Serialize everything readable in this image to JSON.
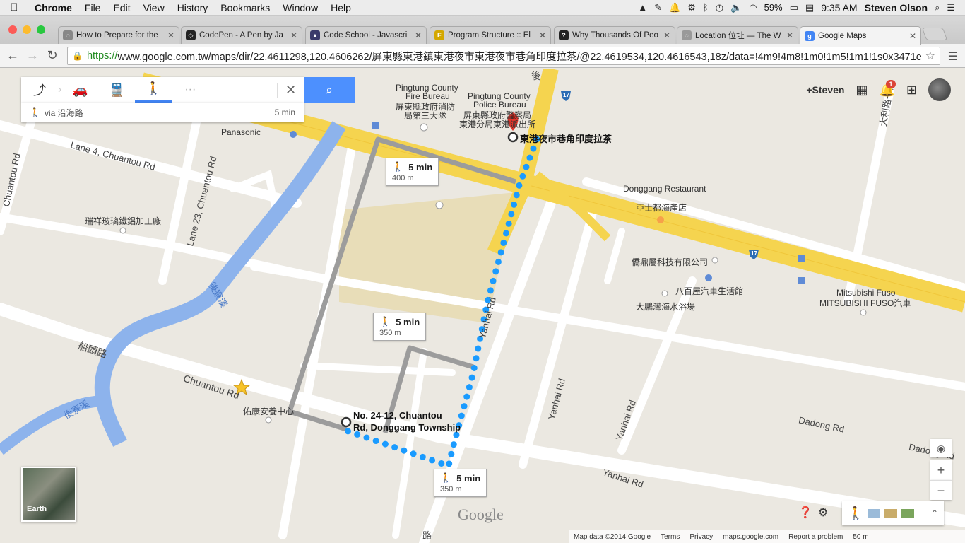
{
  "menubar": {
    "app": "Chrome",
    "menus": [
      "File",
      "Edit",
      "View",
      "History",
      "Bookmarks",
      "Window",
      "Help"
    ],
    "battery": "59%",
    "time": "9:35 AM",
    "user": "Steven Olson"
  },
  "tabs": [
    {
      "title": "How to Prepare for the",
      "color": "#888888"
    },
    {
      "title": "CodePen - A Pen by Ja",
      "color": "#222222"
    },
    {
      "title": "Code School - Javascri",
      "color": "#3a3a6a"
    },
    {
      "title": "Program Structure :: El",
      "color": "#d4a800"
    },
    {
      "title": "Why Thousands Of Peo",
      "color": "#222222"
    },
    {
      "title": "Location 位址 — The W",
      "color": "#999999"
    },
    {
      "title": "Google Maps",
      "color": "#4285f4"
    }
  ],
  "address": {
    "scheme": "https://",
    "rest": "www.google.com.tw/maps/dir/22.4611298,120.4606262/屏東縣東港鎮東港夜市東港夜市巷角印度拉茶/@22.4619534,120.4616543,18z/data=!4m9!4m8!1m0!1m5!1m1!1s0x3471e..."
  },
  "directions": {
    "modes": [
      "best",
      "car",
      "transit",
      "walk"
    ],
    "selected_mode": "walk",
    "more": "···",
    "summary_via": "via 沿海路",
    "summary_time": "5 min"
  },
  "callouts": [
    {
      "time": "5 min",
      "dist": "400 m"
    },
    {
      "time": "5 min",
      "dist": "350 m"
    },
    {
      "time": "5 min",
      "dist": "350 m"
    }
  ],
  "labels": {
    "destination": "東港夜市巷角印度拉茶",
    "origin_line1": "No. 24-12, Chuantou",
    "origin_line2": "Rd, Donggang Township",
    "fire_bureau_en1": "Pingtung County",
    "fire_bureau_en2": "Fire Bureau",
    "fire_bureau_zh1": "屏東縣政府消防",
    "fire_bureau_zh2": "局第三大隊",
    "police_en1": "Pingtung County",
    "police_en2": "Police Bureau",
    "police_zh1": "屏東縣政府警察局",
    "police_zh2": "東港分局東港派出所",
    "panasonic": "Panasonic",
    "lane4": "Lane 4, Chuantou Rd",
    "lane23": "Lane 23, Chuantou Rd",
    "chuantou_v": "Chuantou Rd",
    "chuantou_h": "Chuantou Rd",
    "ruixiang": "瑞祥玻璃鐵鋁加工廠",
    "houzhai1": "後寮溪",
    "houzhai2": "後寮溪",
    "chuantou_zh": "船頭路",
    "youkang": "佑康安養中心",
    "yanhai1": "Yanhai Rd",
    "yanhai2": "Yanhai Rd",
    "yanhai3": "Yanhai Rd",
    "yanhai4": "Yanhai Rd",
    "dadong1": "Dadong Rd",
    "dadong2": "Dadong Rd",
    "donggang_rest": "Donggang Restaurant",
    "yashidu": "亞士都海產店",
    "qiaoding": "僑鼎屬科技有限公司",
    "babai": "八百屋汽車生活館",
    "dapeng": "大鵬灣海水浴場",
    "mitsubishi1": "Mitsubishi Fuso",
    "mitsubishi2": "MITSUBISHI FUSO汽車",
    "dali": "大利路一段",
    "route17a": "17",
    "route17b": "17",
    "road_bottom": "路",
    "hou_top": "後"
  },
  "account": {
    "user": "+Steven",
    "notifications": "1"
  },
  "earth_label": "Earth",
  "google_logo": "Google",
  "footer": {
    "mapdata": "Map data ©2014 Google",
    "terms": "Terms",
    "privacy": "Privacy",
    "site": "maps.google.com",
    "report": "Report a problem",
    "scale": "50 m"
  }
}
